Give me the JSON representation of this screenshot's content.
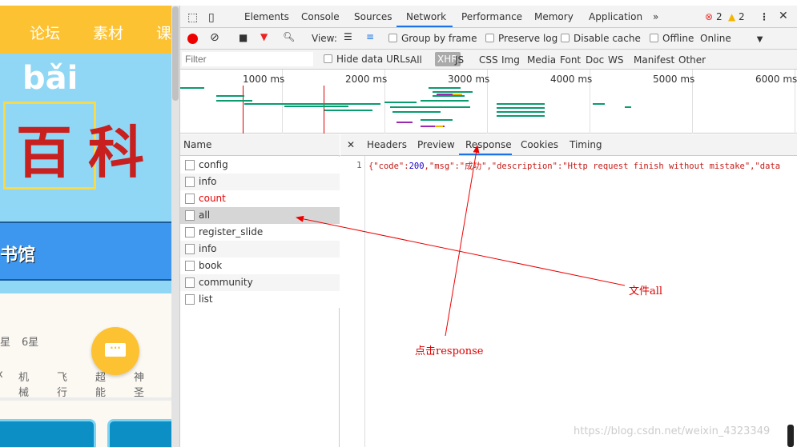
{
  "page": {
    "nav": [
      "论坛",
      "素材",
      "课"
    ],
    "banner_text": "百科",
    "pinyin": "bǎi",
    "library_text": "书馆",
    "stars": [
      "星",
      "6星"
    ],
    "categories": [
      "x",
      "机械",
      "飞行",
      "超能",
      "神圣"
    ]
  },
  "devtools": {
    "tabs": [
      "Elements",
      "Console",
      "Sources",
      "Network",
      "Performance",
      "Memory",
      "Application"
    ],
    "active_tab": "Network",
    "more": "»",
    "errors": "2",
    "warnings": "2",
    "toolbar": {
      "view_label": "View:",
      "group_by_frame": "Group by frame",
      "preserve_log": "Preserve log",
      "disable_cache": "Disable cache",
      "offline": "Offline",
      "throttle": "Online"
    },
    "filter": {
      "placeholder": "Filter",
      "hide_data_urls": "Hide data URLs",
      "types": [
        "All",
        "XHR",
        "JS",
        "CSS",
        "Img",
        "Media",
        "Font",
        "Doc",
        "WS",
        "Manifest",
        "Other"
      ],
      "active_type": "XHR"
    },
    "timeline_ticks": [
      "1000 ms",
      "2000 ms",
      "3000 ms",
      "4000 ms",
      "5000 ms",
      "6000 ms"
    ],
    "name_header": "Name",
    "requests": [
      {
        "name": "config"
      },
      {
        "name": "info"
      },
      {
        "name": "count",
        "error": true
      },
      {
        "name": "all",
        "selected": true
      },
      {
        "name": "register_slide"
      },
      {
        "name": "info"
      },
      {
        "name": "book"
      },
      {
        "name": "community"
      },
      {
        "name": "list"
      }
    ],
    "detail_tabs": [
      "Headers",
      "Preview",
      "Response",
      "Cookies",
      "Timing"
    ],
    "active_detail_tab": "Response",
    "response": {
      "line": "1",
      "p1": "{\"code\":",
      "code": "200",
      "p2": ",\"msg\":\"成功\",\"description\":\"Http request finish without mistake\",\"data"
    }
  },
  "annotations": {
    "file_all": "文件all",
    "click_response": "点击response"
  },
  "watermark": "https://blog.csdn.net/weixin_4323349"
}
